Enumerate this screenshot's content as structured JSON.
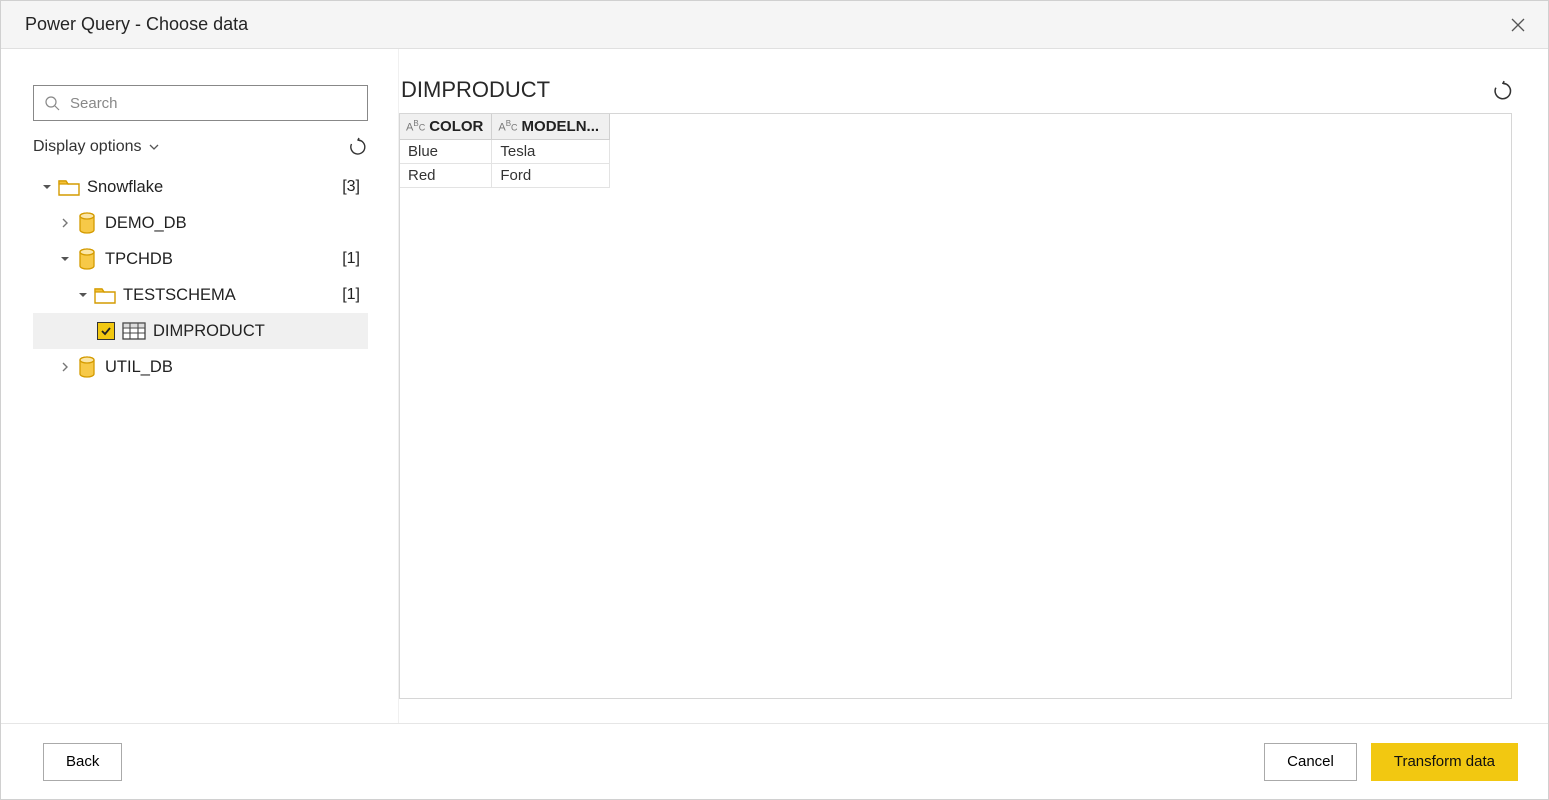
{
  "window": {
    "title": "Power Query - Choose data"
  },
  "sidebar": {
    "search_placeholder": "Search",
    "display_options_label": "Display options",
    "tree": {
      "root": {
        "label": "Snowflake",
        "count": "[3]"
      },
      "nodes": [
        {
          "label": "DEMO_DB"
        },
        {
          "label": "TPCHDB",
          "count": "[1]",
          "children": [
            {
              "label": "TESTSCHEMA",
              "count": "[1]",
              "children": [
                {
                  "label": "DIMPRODUCT",
                  "checked": true
                }
              ]
            }
          ]
        },
        {
          "label": "UTIL_DB"
        }
      ]
    }
  },
  "preview": {
    "title": "DIMPRODUCT",
    "columns": [
      {
        "type": "ABC",
        "name": "COLOR"
      },
      {
        "type": "ABC",
        "name": "MODELN..."
      }
    ],
    "rows": [
      [
        "Blue",
        "Tesla"
      ],
      [
        "Red",
        "Ford"
      ]
    ]
  },
  "footer": {
    "back": "Back",
    "cancel": "Cancel",
    "transform": "Transform data"
  }
}
